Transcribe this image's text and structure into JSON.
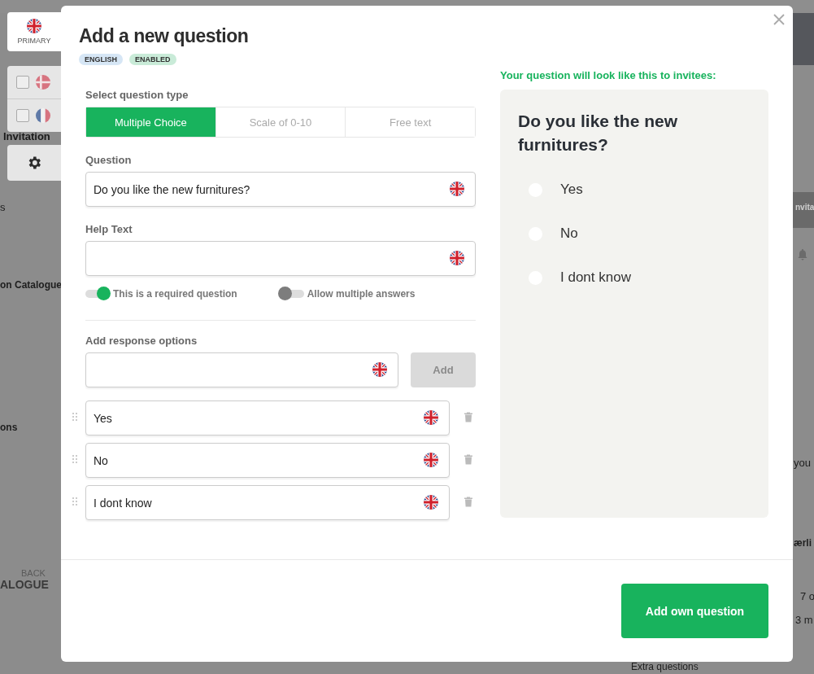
{
  "background_page": {
    "fragments": [
      {
        "text": "Invitation",
        "kind": "heading"
      },
      {
        "text": "s",
        "kind": "plain"
      },
      {
        "text": "on Catalogue",
        "kind": "bold"
      },
      {
        "text": "ons",
        "kind": "bold"
      },
      {
        "text": "BACK",
        "kind": "small"
      },
      {
        "text": "ALOGUE",
        "kind": "button"
      },
      {
        "text": "nvita",
        "kind": "faded"
      },
      {
        "text": "you",
        "kind": "plain"
      },
      {
        "text": "ærli",
        "kind": "bold"
      },
      {
        "text": "7 o",
        "kind": "plain"
      },
      {
        "text": "3 m",
        "kind": "plain"
      },
      {
        "text": "Extra questions",
        "kind": "plain"
      }
    ]
  },
  "languages": [
    {
      "kind": "uk",
      "label": "PRIMARY",
      "selected": true
    },
    {
      "kind": "dk",
      "checked": false
    },
    {
      "kind": "fr",
      "checked": false
    }
  ],
  "modal": {
    "title": "Add a new question",
    "badges": [
      {
        "label": "ENGLISH",
        "color": "#d6e6f5"
      },
      {
        "label": "ENABLED",
        "color": "#c9ebd8"
      }
    ],
    "question_type": {
      "label": "Select question type",
      "options": [
        {
          "label": "Multiple Choice",
          "selected": true
        },
        {
          "label": "Scale of 0-10",
          "selected": false
        },
        {
          "label": "Free text",
          "selected": false
        }
      ]
    },
    "question": {
      "label": "Question",
      "value": "Do you like the new furnitures?"
    },
    "help_text": {
      "label": "Help Text"
    },
    "toggles": [
      {
        "label": "This is a required question",
        "on": true
      },
      {
        "label": "Allow multiple answers",
        "on": false
      }
    ],
    "response_options": {
      "label": "Add response options",
      "add_button": {
        "label": "Add",
        "disabled": true
      },
      "options": [
        {
          "value": "Yes"
        },
        {
          "value": "No"
        },
        {
          "value": "I dont know"
        }
      ]
    },
    "preview": {
      "heading": "Your question will look like this to invitees:",
      "question": "Do you like the new furnitures?",
      "options": [
        {
          "label": "Yes",
          "selected": false
        },
        {
          "label": "No",
          "selected": false
        },
        {
          "label": "I dont know",
          "selected": false
        }
      ]
    },
    "submit": "Add own question"
  }
}
